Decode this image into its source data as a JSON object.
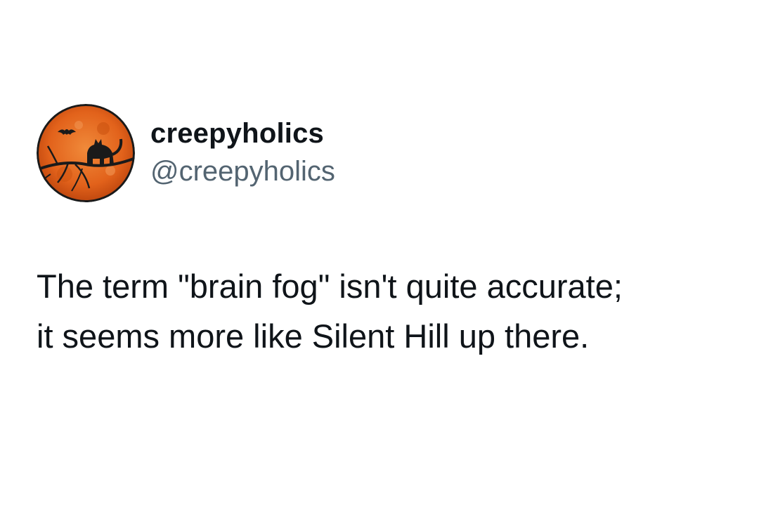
{
  "author": {
    "display_name": "creepyholics",
    "handle": "@creepyholics",
    "avatar_icon": "orange-moon-black-cat-bat-icon"
  },
  "tweet": {
    "lines": [
      "The term \"brain fog\" isn't quite accurate;",
      "it seems more like Silent Hill up there."
    ]
  },
  "colors": {
    "background": "#ffffff",
    "text_primary": "#0f1419",
    "text_secondary": "#536471",
    "avatar_moon": "#e2621b"
  }
}
